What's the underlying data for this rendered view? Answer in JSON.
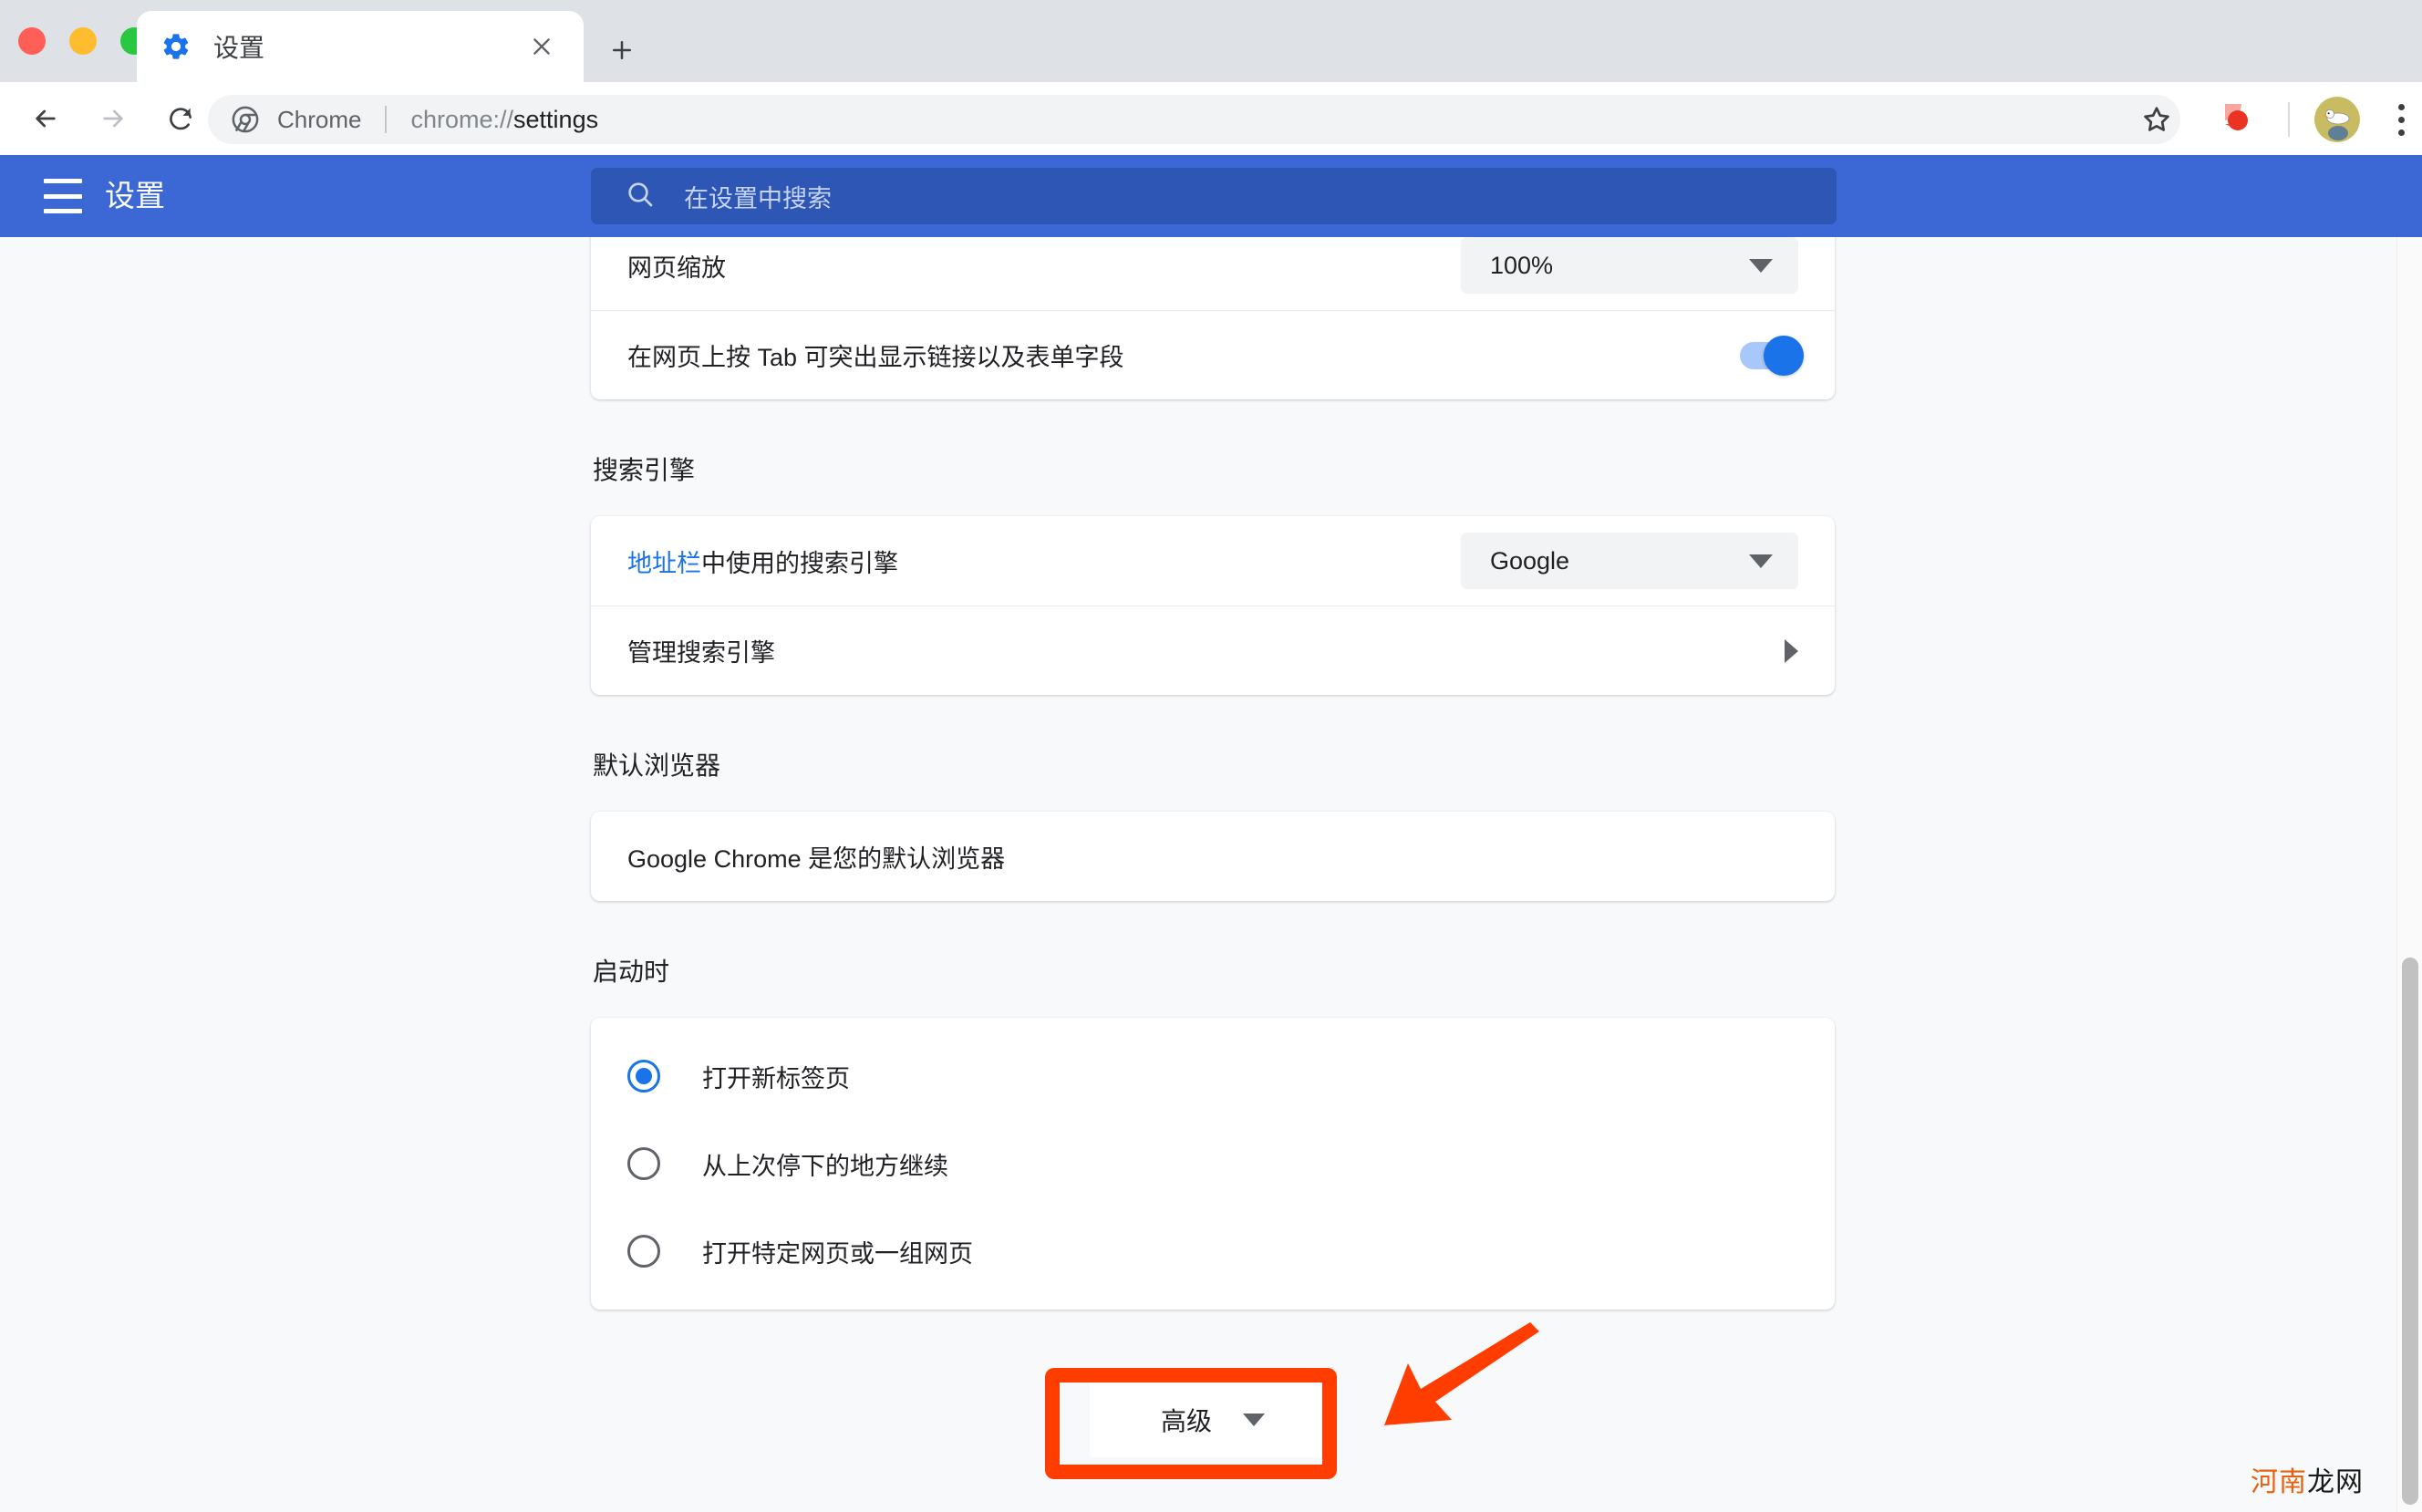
{
  "browser": {
    "window_controls": [
      "close",
      "minimize",
      "maximize"
    ],
    "tab": {
      "title": "设置",
      "favicon": "gear-icon",
      "close_label": "×"
    },
    "new_tab_label": "+",
    "nav": {
      "back_label": "←",
      "forward_label": "→",
      "reload_label": "⟳"
    },
    "omnibox": {
      "chip_label": "Chrome",
      "url_scheme": "chrome://",
      "url_host": "settings"
    },
    "actions": {
      "bookmark_label": "☆",
      "extension_name": "extension-icon",
      "avatar_name": "profile-avatar",
      "menu_label": "⋮"
    }
  },
  "settings_header": {
    "menu_label": "菜单",
    "title": "设置",
    "search_placeholder": "在设置中搜索"
  },
  "appearance": {
    "rows": [
      {
        "label": "网页缩放",
        "control": "select",
        "value": "100%"
      },
      {
        "label": "在网页上按 Tab 可突出显示链接以及表单字段",
        "control": "toggle",
        "value": "on"
      }
    ]
  },
  "search_engine": {
    "section_title": "搜索引擎",
    "row_link_text": "地址栏",
    "row_rest_text": "中使用的搜索引擎",
    "selected_engine": "Google",
    "manage_label": "管理搜索引擎"
  },
  "default_browser": {
    "section_title": "默认浏览器",
    "status_text": "Google Chrome 是您的默认浏览器"
  },
  "on_startup": {
    "section_title": "启动时",
    "options": [
      {
        "label": "打开新标签页",
        "selected": true
      },
      {
        "label": "从上次停下的地方继续",
        "selected": false
      },
      {
        "label": "打开特定网页或一组网页",
        "selected": false
      }
    ]
  },
  "advanced": {
    "label": "高级",
    "caret": "chevron-down-icon"
  },
  "annotation": {
    "color": "#ff3d00",
    "target": "advanced-button",
    "arrow_direction": "down-left"
  },
  "watermark": {
    "part_a": "河南",
    "part_b": "龙网"
  },
  "colors": {
    "header_blue": "#3b68d4",
    "search_blue": "#2d56b5",
    "accent_blue": "#1a73e8",
    "page_bg": "#f8f9fa",
    "tabstrip": "#dee1e6",
    "annotation": "#ff3d00"
  }
}
